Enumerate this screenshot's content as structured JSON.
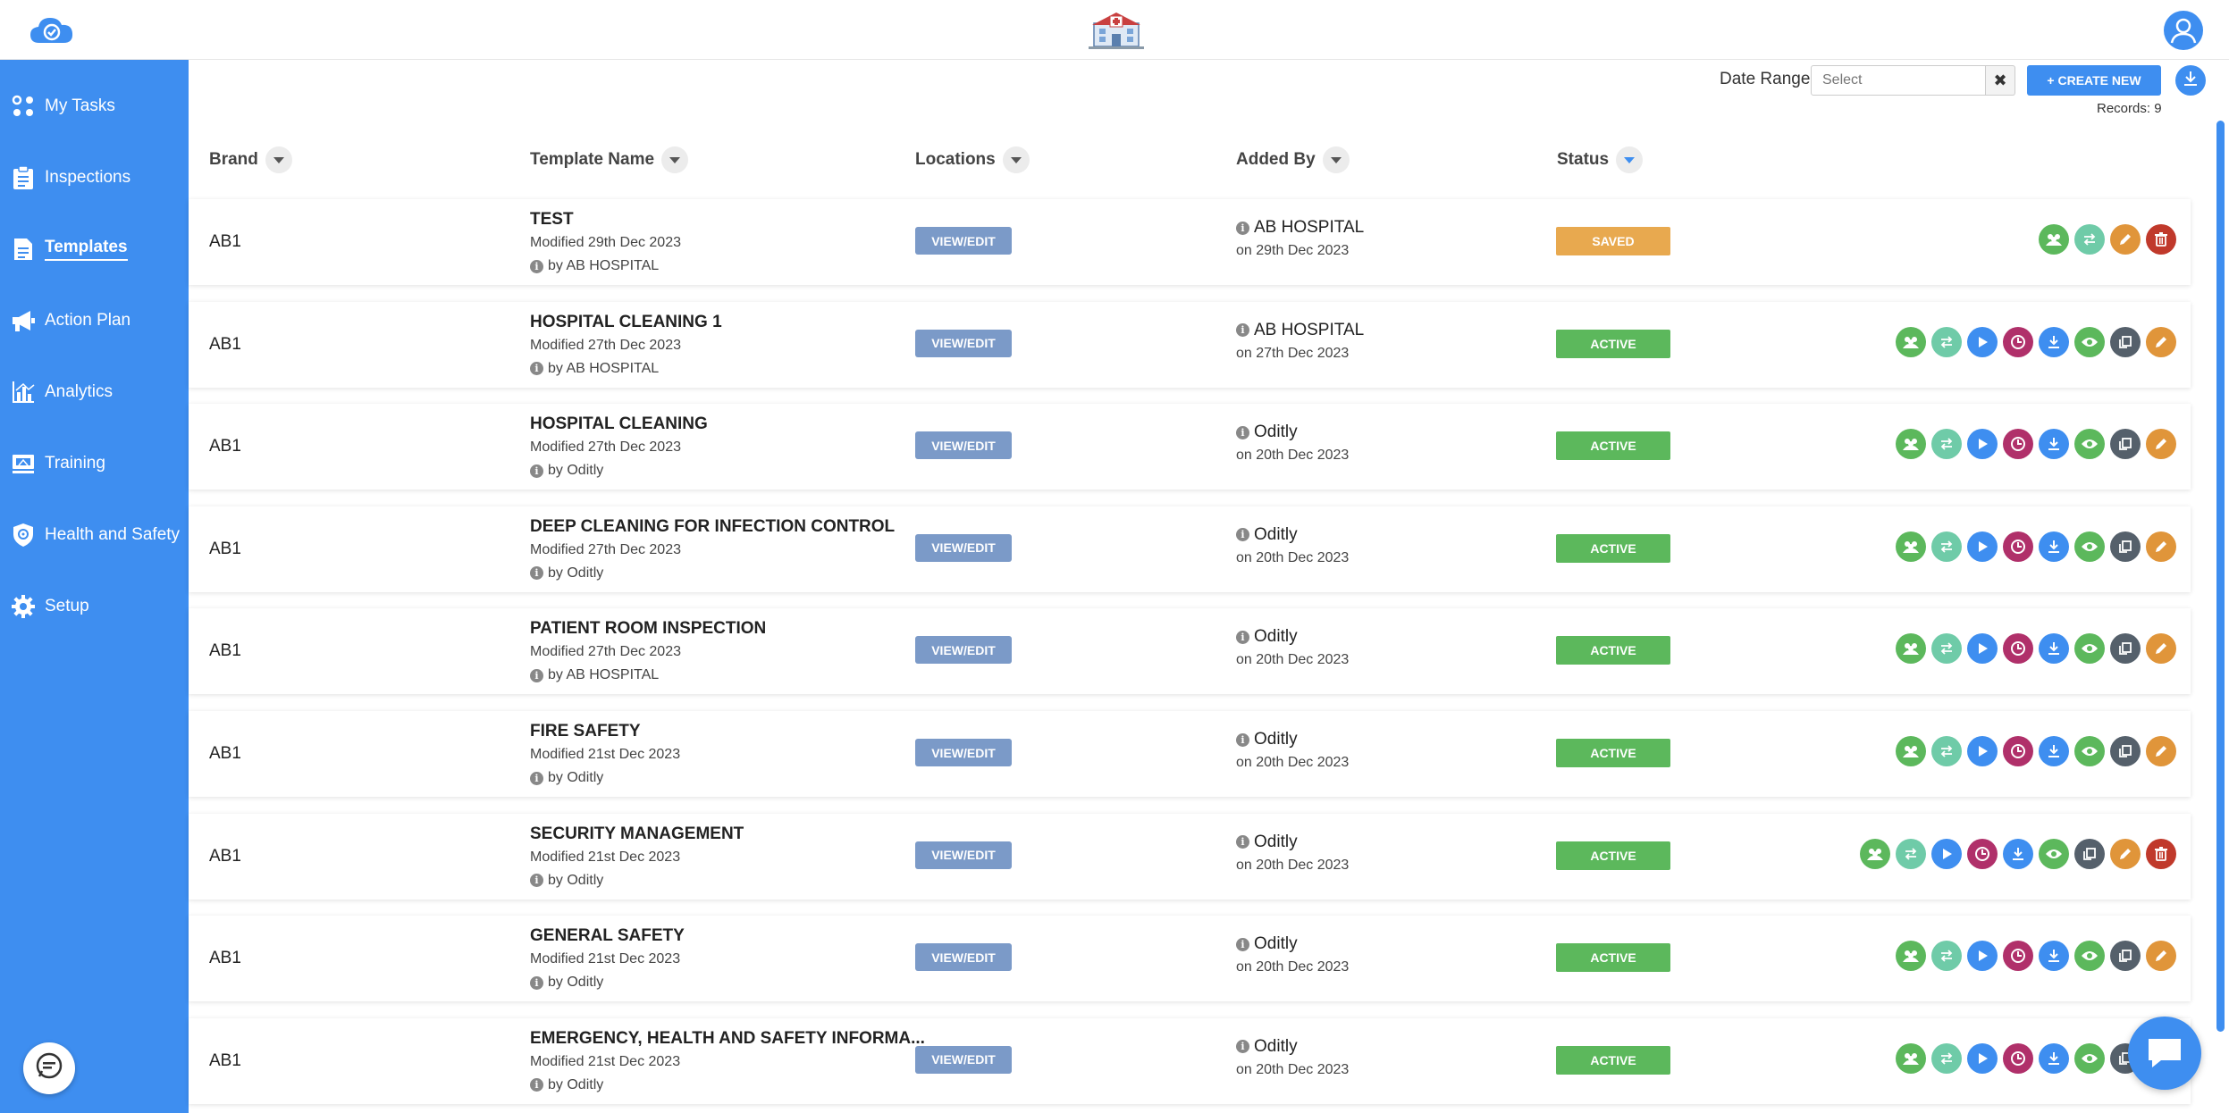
{
  "sidebar": {
    "items": [
      {
        "label": "My Tasks",
        "icon": "dots-grid-icon"
      },
      {
        "label": "Inspections",
        "icon": "clipboard-icon"
      },
      {
        "label": "Templates",
        "icon": "document-icon",
        "active": true
      },
      {
        "label": "Action Plan",
        "icon": "megaphone-icon"
      },
      {
        "label": "Analytics",
        "icon": "bar-chart-icon"
      },
      {
        "label": "Training",
        "icon": "training-board-icon"
      },
      {
        "label": "Health and Safety",
        "icon": "shield-icon"
      },
      {
        "label": "Setup",
        "icon": "gear-icon"
      }
    ]
  },
  "toolbar": {
    "date_range_label": "Date Range",
    "date_placeholder": "Select",
    "create_label": "+ CREATE NEW",
    "records_label": "Records: 9"
  },
  "table": {
    "headers": {
      "brand": "Brand",
      "template_name": "Template Name",
      "locations": "Locations",
      "added_by": "Added By",
      "status": "Status"
    },
    "view_edit_label": "VIEW/EDIT",
    "rows": [
      {
        "brand": "AB1",
        "name": "TEST",
        "modified": "Modified 29th Dec 2023",
        "by": "by AB HOSPITAL",
        "added_by": "AB HOSPITAL",
        "added_on": "on 29th Dec 2023",
        "status": "SAVED",
        "status_color": "#e8a94f",
        "actions": [
          "users",
          "swap",
          "edit",
          "delete"
        ]
      },
      {
        "brand": "AB1",
        "name": "HOSPITAL CLEANING 1",
        "modified": "Modified 27th Dec 2023",
        "by": "by AB HOSPITAL",
        "added_by": "AB HOSPITAL",
        "added_on": "on 27th Dec 2023",
        "status": "ACTIVE",
        "status_color": "#5cb85c",
        "actions": [
          "users",
          "swap",
          "play",
          "clock",
          "download",
          "eye",
          "copy",
          "edit"
        ]
      },
      {
        "brand": "AB1",
        "name": "HOSPITAL CLEANING",
        "modified": "Modified 27th Dec 2023",
        "by": "by Oditly",
        "added_by": "Oditly",
        "added_on": "on 20th Dec 2023",
        "status": "ACTIVE",
        "status_color": "#5cb85c",
        "actions": [
          "users",
          "swap",
          "play",
          "clock",
          "download",
          "eye",
          "copy",
          "edit"
        ]
      },
      {
        "brand": "AB1",
        "name": "DEEP CLEANING FOR INFECTION CONTROL",
        "modified": "Modified 27th Dec 2023",
        "by": "by Oditly",
        "added_by": "Oditly",
        "added_on": "on 20th Dec 2023",
        "status": "ACTIVE",
        "status_color": "#5cb85c",
        "actions": [
          "users",
          "swap",
          "play",
          "clock",
          "download",
          "eye",
          "copy",
          "edit"
        ]
      },
      {
        "brand": "AB1",
        "name": "PATIENT ROOM INSPECTION",
        "modified": "Modified 27th Dec 2023",
        "by": "by AB HOSPITAL",
        "added_by": "Oditly",
        "added_on": "on 20th Dec 2023",
        "status": "ACTIVE",
        "status_color": "#5cb85c",
        "actions": [
          "users",
          "swap",
          "play",
          "clock",
          "download",
          "eye",
          "copy",
          "edit"
        ]
      },
      {
        "brand": "AB1",
        "name": "FIRE SAFETY",
        "modified": "Modified 21st Dec 2023",
        "by": "by Oditly",
        "added_by": "Oditly",
        "added_on": "on 20th Dec 2023",
        "status": "ACTIVE",
        "status_color": "#5cb85c",
        "actions": [
          "users",
          "swap",
          "play",
          "clock",
          "download",
          "eye",
          "copy",
          "edit"
        ]
      },
      {
        "brand": "AB1",
        "name": "SECURITY MANAGEMENT",
        "modified": "Modified 21st Dec 2023",
        "by": "by Oditly",
        "added_by": "Oditly",
        "added_on": "on 20th Dec 2023",
        "status": "ACTIVE",
        "status_color": "#5cb85c",
        "actions": [
          "users",
          "swap",
          "play",
          "clock",
          "download",
          "eye",
          "copy",
          "edit",
          "delete"
        ]
      },
      {
        "brand": "AB1",
        "name": "GENERAL SAFETY",
        "modified": "Modified 21st Dec 2023",
        "by": "by Oditly",
        "added_by": "Oditly",
        "added_on": "on 20th Dec 2023",
        "status": "ACTIVE",
        "status_color": "#5cb85c",
        "actions": [
          "users",
          "swap",
          "play",
          "clock",
          "download",
          "eye",
          "copy",
          "edit"
        ]
      },
      {
        "brand": "AB1",
        "name": "EMERGENCY, HEALTH AND SAFETY INFORMA...",
        "modified": "Modified 21st Dec 2023",
        "by": "by Oditly",
        "added_by": "Oditly",
        "added_on": "on 20th Dec 2023",
        "status": "ACTIVE",
        "status_color": "#5cb85c",
        "actions": [
          "users",
          "swap",
          "play",
          "clock",
          "download",
          "eye",
          "copy",
          "edit"
        ]
      }
    ]
  },
  "colors": {
    "accent": "#3e8ef0",
    "action_users": "#5cb85c",
    "action_swap": "#6fcba8",
    "action_play": "#3e8ef0",
    "action_clock": "#b0306a",
    "action_download": "#3e8ef0",
    "action_eye": "#5cb85c",
    "action_copy": "#55606b",
    "action_edit": "#e0953a",
    "action_delete": "#c0392b"
  }
}
